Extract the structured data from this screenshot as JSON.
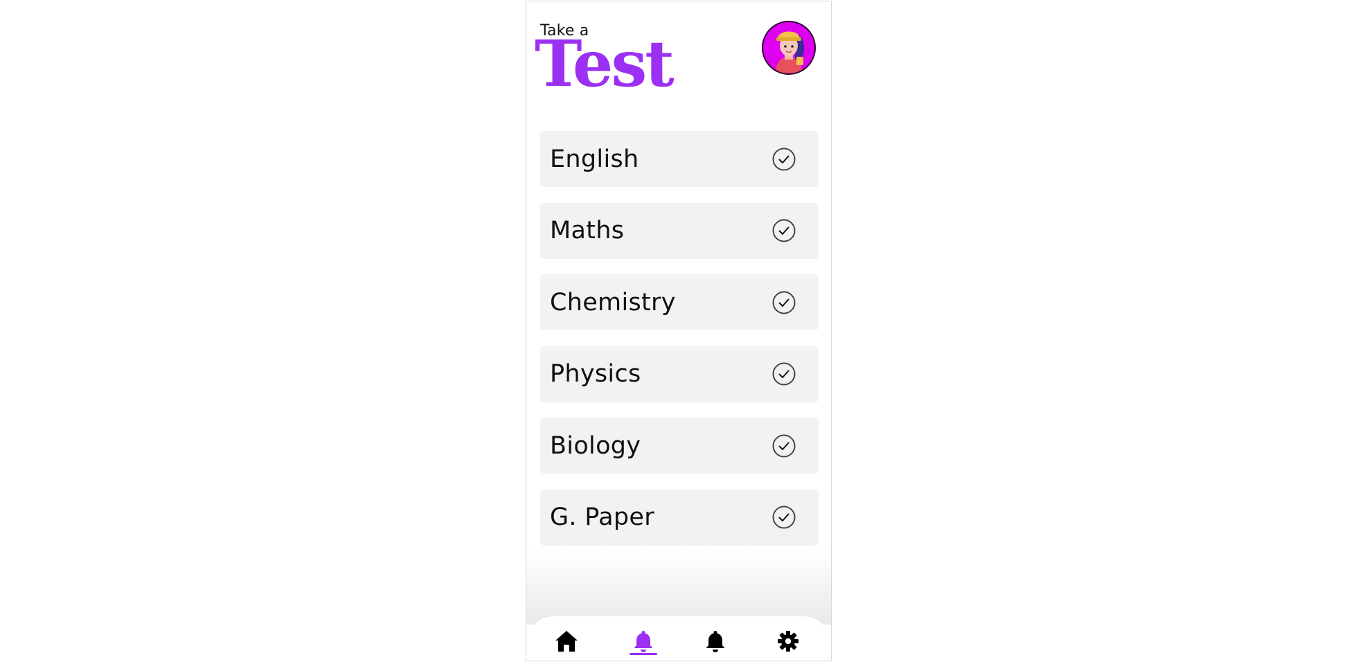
{
  "header": {
    "kicker": "Take a",
    "title": "Test"
  },
  "avatar": {
    "icon": "avatar-icon"
  },
  "subjects": [
    {
      "label": "English",
      "icon": "check-circle-icon"
    },
    {
      "label": "Maths",
      "icon": "check-circle-icon"
    },
    {
      "label": "Chemistry",
      "icon": "check-circle-icon"
    },
    {
      "label": "Physics",
      "icon": "check-circle-icon"
    },
    {
      "label": "Biology",
      "icon": "check-circle-icon"
    },
    {
      "label": "G. Paper",
      "icon": "check-circle-icon"
    }
  ],
  "nav": {
    "items": [
      {
        "icon": "home-icon",
        "active": false
      },
      {
        "icon": "bell-icon",
        "active": true
      },
      {
        "icon": "bell-icon",
        "active": false
      },
      {
        "icon": "gear-icon",
        "active": false
      }
    ]
  },
  "colors": {
    "accent": "#9b30f2",
    "avatar_bg": "#e000f0",
    "card_bg": "#f1f2f4",
    "text": "#111111"
  }
}
